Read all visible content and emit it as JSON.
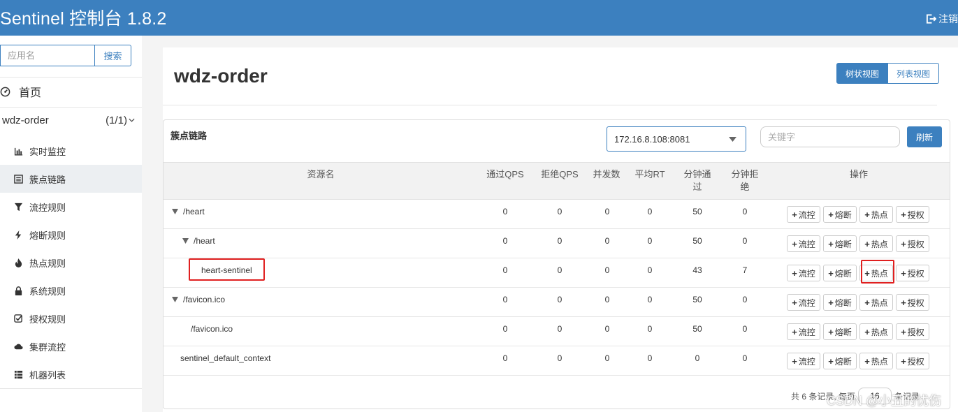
{
  "header": {
    "title": "Sentinel 控制台 1.8.2",
    "logout_label": "注销"
  },
  "sidebar": {
    "search_placeholder": "应用名",
    "search_button": "搜索",
    "home_label": "首页",
    "app_name": "wdz-order",
    "app_count": "(1/1)",
    "items": [
      {
        "label": "实时监控",
        "icon": "bar-chart-icon"
      },
      {
        "label": "簇点链路",
        "icon": "list-icon"
      },
      {
        "label": "流控规则",
        "icon": "filter-icon"
      },
      {
        "label": "熔断规则",
        "icon": "flash-icon"
      },
      {
        "label": "热点规则",
        "icon": "fire-icon"
      },
      {
        "label": "系统规则",
        "icon": "lock-icon"
      },
      {
        "label": "授权规则",
        "icon": "check-icon"
      },
      {
        "label": "集群流控",
        "icon": "cloud-icon"
      },
      {
        "label": "机器列表",
        "icon": "th-list-icon"
      }
    ],
    "active_index": 1
  },
  "main": {
    "title": "wdz-order",
    "view_tree": "树状视图",
    "view_list": "列表视图",
    "panel_title": "簇点链路",
    "machine": "172.16.8.108:8081",
    "keyword_placeholder": "关键字",
    "refresh": "刷新"
  },
  "table": {
    "headers": {
      "resource": "资源名",
      "pass_qps": "通过QPS",
      "block_qps": "拒绝QPS",
      "concurrency": "并发数",
      "avg_rt": "平均RT",
      "pass_min_1": "分钟通",
      "pass_min_2": "过",
      "block_min_1": "分钟拒",
      "block_min_2": "绝",
      "ops": "操作"
    },
    "rows": [
      {
        "name": "/heart",
        "pass_qps": "0",
        "block_qps": "0",
        "concurrency": "0",
        "avg_rt": "0",
        "pass_min": "50",
        "block_min": "0"
      },
      {
        "name": "/heart",
        "pass_qps": "0",
        "block_qps": "0",
        "concurrency": "0",
        "avg_rt": "0",
        "pass_min": "50",
        "block_min": "0"
      },
      {
        "name": "heart-sentinel",
        "pass_qps": "0",
        "block_qps": "0",
        "concurrency": "0",
        "avg_rt": "0",
        "pass_min": "43",
        "block_min": "7"
      },
      {
        "name": "/favicon.ico",
        "pass_qps": "0",
        "block_qps": "0",
        "concurrency": "0",
        "avg_rt": "0",
        "pass_min": "50",
        "block_min": "0"
      },
      {
        "name": "/favicon.ico",
        "pass_qps": "0",
        "block_qps": "0",
        "concurrency": "0",
        "avg_rt": "0",
        "pass_min": "50",
        "block_min": "0"
      },
      {
        "name": "sentinel_default_context",
        "pass_qps": "0",
        "block_qps": "0",
        "concurrency": "0",
        "avg_rt": "0",
        "pass_min": "0",
        "block_min": "0"
      }
    ],
    "op_labels": {
      "flow": "流控",
      "degrade": "熔断",
      "hot": "热点",
      "auth": "授权"
    }
  },
  "footer": {
    "total": "共 6 条记录, 每页",
    "page_size": "16",
    "suffix": "条记录"
  },
  "watermark": "CSDN @小丑的忧伤",
  "colors": {
    "primary": "#3c80bf",
    "highlight": "#e02020"
  }
}
